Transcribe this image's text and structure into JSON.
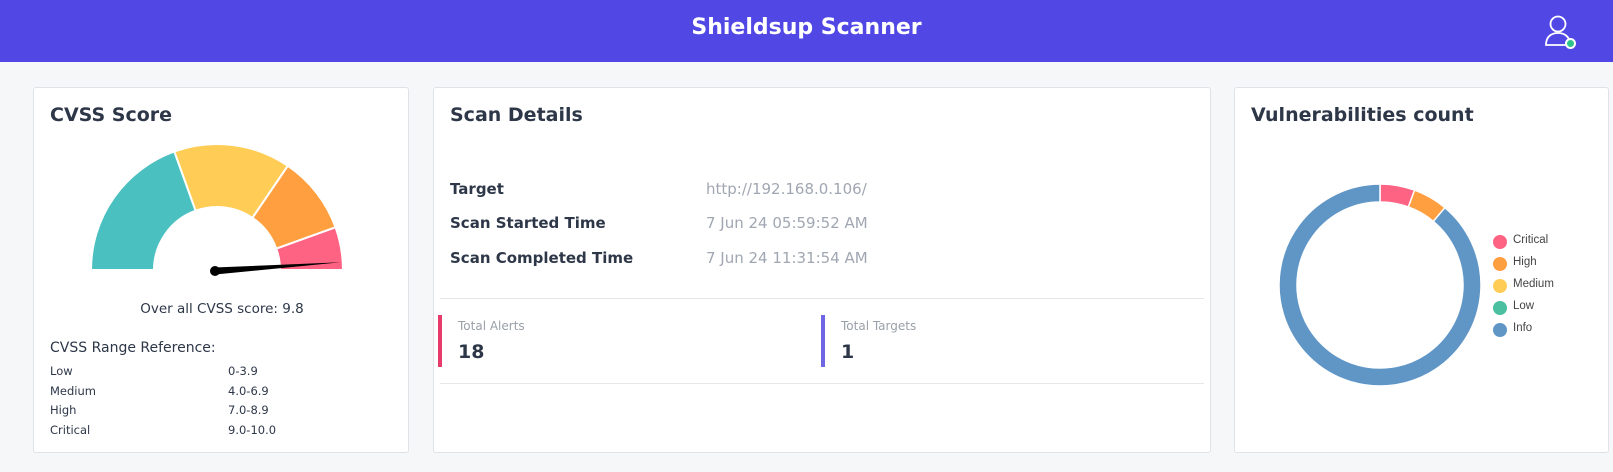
{
  "header": {
    "title": "Shieldsup Scanner"
  },
  "cvss": {
    "title": "CVSS Score",
    "overall_label": "Over all CVSS score: 9.8",
    "score": 9.8,
    "range_title": "CVSS Range Reference:",
    "ranges": [
      {
        "label": "Low",
        "range": "0-3.9",
        "color": "#4bc0c0"
      },
      {
        "label": "Medium",
        "range": "4.0-6.9",
        "color": "#ffcd56"
      },
      {
        "label": "High",
        "range": "7.0-8.9",
        "color": "#ff9f40"
      },
      {
        "label": "Critical",
        "range": "9.0-10.0",
        "color": "#ff6384"
      }
    ]
  },
  "scan": {
    "title": "Scan Details",
    "target_label": "Target",
    "target_value": "http://192.168.0.106/",
    "started_label": "Scan Started Time",
    "started_value": "7 Jun 24 05:59:52 AM",
    "completed_label": "Scan Completed Time",
    "completed_value": "7 Jun 24 11:31:54 AM",
    "alerts_label": "Total Alerts",
    "alerts_value": "18",
    "targets_label": "Total Targets",
    "targets_value": "1"
  },
  "vulns": {
    "title": "Vulnerabilities count",
    "chart_data": {
      "type": "pie",
      "categories": [
        "Critical",
        "High",
        "Medium",
        "Low",
        "Info"
      ],
      "values": [
        1,
        1,
        0,
        0,
        16
      ],
      "colors": [
        "#ff6384",
        "#ff9f40",
        "#ffcd56",
        "#4bc0a0",
        "#5f96c6"
      ],
      "legend": "right"
    }
  }
}
